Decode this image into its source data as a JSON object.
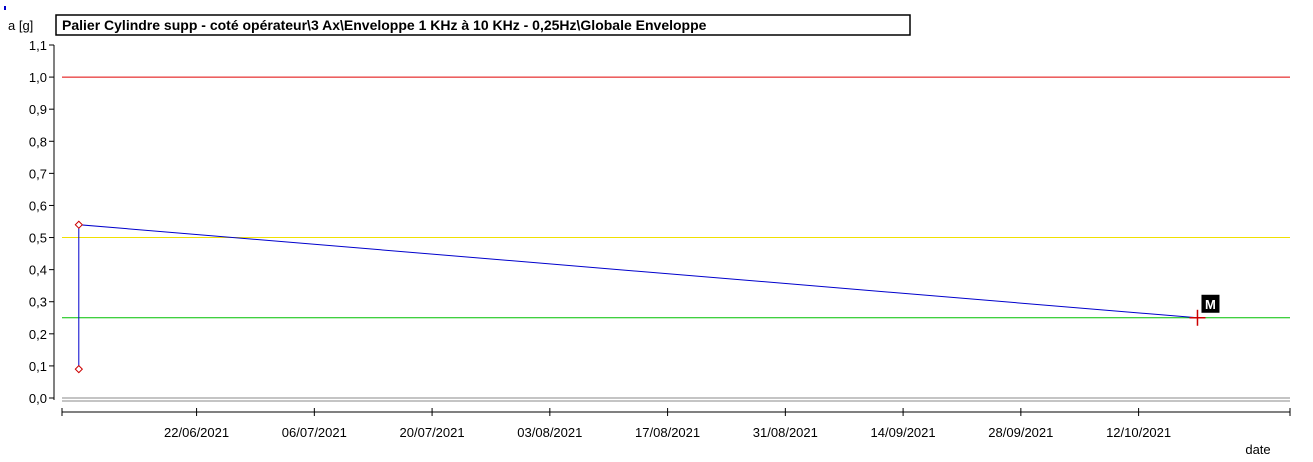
{
  "chart_data": {
    "type": "line",
    "title": "Palier Cylindre supp - coté opérateur\\3 Ax\\Enveloppe 1 KHz à 10 KHz - 0,25Hz\\Globale Enveloppe",
    "ylabel": "a [g]",
    "xlabel": "date",
    "ylim": [
      0,
      1.1
    ],
    "y_ticks": [
      "0,0",
      "0,1",
      "0,2",
      "0,3",
      "0,4",
      "0,5",
      "0,6",
      "0,7",
      "0,8",
      "0,9",
      "1,0",
      "1,1"
    ],
    "x_tick_labels": [
      "22/06/2021",
      "06/07/2021",
      "20/07/2021",
      "03/08/2021",
      "17/08/2021",
      "31/08/2021",
      "14/09/2021",
      "28/09/2021",
      "12/10/2021"
    ],
    "xlim": [
      "2021-06-06",
      "2021-10-30"
    ],
    "series": [
      {
        "color": "#0000cc",
        "points": [
          {
            "x": "2021-06-08",
            "y": 0.09
          },
          {
            "x": "2021-06-08",
            "y": 0.54
          },
          {
            "x": "2021-10-19",
            "y": 0.25
          }
        ]
      }
    ],
    "markers": [
      {
        "x": "2021-06-08",
        "y": 0.54,
        "shape": "diamond",
        "color": "#cc0000"
      },
      {
        "x": "2021-06-08",
        "y": 0.09,
        "shape": "diamond",
        "color": "#cc0000"
      },
      {
        "x": "2021-10-19",
        "y": 0.25,
        "shape": "cross",
        "color": "#cc0000"
      }
    ],
    "thresholds": [
      {
        "y": 1.0,
        "color": "#e00000"
      },
      {
        "y": 0.5,
        "color": "#f0e000"
      },
      {
        "y": 0.25,
        "color": "#00c000"
      }
    ],
    "cursor_label": "M",
    "grid": false
  }
}
